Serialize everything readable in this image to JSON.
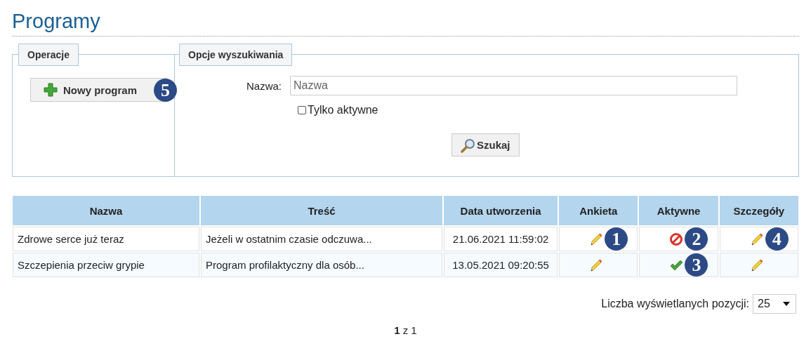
{
  "title": "Programy",
  "operations": {
    "legend": "Operacje",
    "new_button": {
      "label": "Nowy program",
      "marker": "5"
    }
  },
  "search": {
    "legend": "Opcje wyszukiwania",
    "name_label": "Nazwa:",
    "name_placeholder": "Nazwa",
    "only_active": {
      "label": "Tylko aktywne",
      "checked": false
    },
    "button": "Szukaj"
  },
  "table": {
    "columns": [
      "Nazwa",
      "Treść",
      "Data utworzenia",
      "Ankieta",
      "Aktywne",
      "Szczegóły"
    ],
    "rows": [
      {
        "name": "Zdrowe serce już teraz",
        "content": "Jeżeli w ostatnim czasie odczuwa...",
        "created": "21.06.2021 11:59:02",
        "survey_marker": "1",
        "active": false,
        "active_marker": "2",
        "details_marker": "4"
      },
      {
        "name": "Szczepienia przeciw grypie",
        "content": "Program profilaktyczny dla osób...",
        "created": "13.05.2021 09:20:55",
        "active": true,
        "active_marker": "3"
      }
    ]
  },
  "page_size": {
    "label": "Liczba wyświetlanych pozycji:",
    "value": "25"
  },
  "pager": {
    "current": "1",
    "rest": "z 1"
  }
}
